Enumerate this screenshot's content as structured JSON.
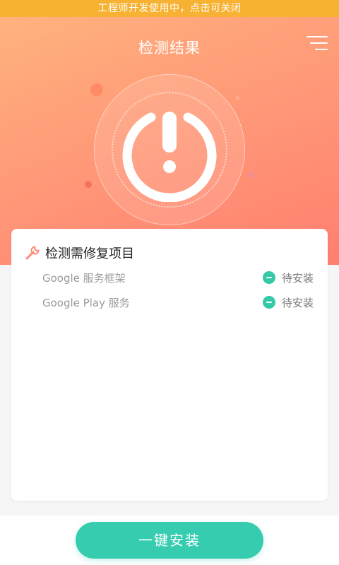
{
  "dev_banner": {
    "text": "工程师开发使用中，点击可关闭"
  },
  "header": {
    "title": "检测结果",
    "menu_icon": "menu-icon"
  },
  "result": {
    "status_icon": "warning-power-icon"
  },
  "card": {
    "title_icon": "wrench-icon",
    "title": "检测需修复项目",
    "items": [
      {
        "name": "Google 服务框架",
        "status": "待安装",
        "status_icon": "minus-circle-icon"
      },
      {
        "name": "Google Play 服务",
        "status": "待安装",
        "status_icon": "minus-circle-icon"
      }
    ]
  },
  "footer": {
    "install_label": "一键安装"
  },
  "colors": {
    "banner": "#f7b233",
    "hero_gradient_start": "#ffb27e",
    "hero_gradient_end": "#ff7f70",
    "accent": "#35ccb0",
    "status_dot": "#36c9a9"
  }
}
